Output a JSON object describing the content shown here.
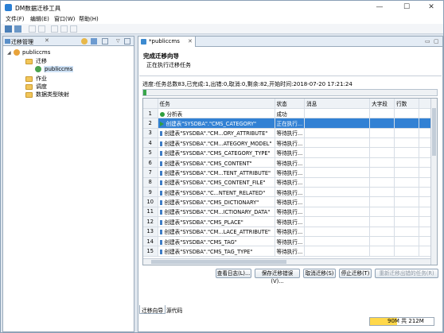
{
  "window": {
    "title": "DM数据迁移工具",
    "min": "—",
    "max": "☐",
    "close": "✕"
  },
  "menu": [
    "文件(F)",
    "编辑(E)",
    "窗口(W)",
    "帮助(H)"
  ],
  "left_panel": {
    "tab_label": "迁移管理",
    "tree": {
      "root": "publiccms",
      "migration_folder": "迁移",
      "migration_item": "publiccms",
      "job_folder": "作业",
      "schedule_folder": "调度",
      "type_map_folder": "数据类型映射"
    }
  },
  "editor_tab": {
    "label": "*publiccms"
  },
  "wizard": {
    "title": "完成迁移向导",
    "subtitle": "正在执行迁移任务",
    "progress_text": "进度:任务总数83,已完成:1,出错:0,取消:0,剩余:82,开始时间:2018-07-20 17:21:24",
    "progress_fraction": 0.012
  },
  "grid": {
    "columns": [
      "任务",
      "状态",
      "消息",
      "大字段",
      "行数"
    ],
    "rows": [
      {
        "num": "1",
        "task": "分析表",
        "status": "成功",
        "icon": "ok"
      },
      {
        "num": "2",
        "task": "创建表\"SYSDBA\".\"CMS_CATEGORY\"",
        "status": "正在执行...",
        "icon": "run"
      },
      {
        "num": "3",
        "task": "创建表\"SYSDBA\".\"CM...ORY_ATTRIBUTE\"",
        "status": "等待执行...",
        "icon": "wait"
      },
      {
        "num": "4",
        "task": "创建表\"SYSDBA\".\"CM...ATEGORY_MODEL\"",
        "status": "等待执行...",
        "icon": "wait"
      },
      {
        "num": "5",
        "task": "创建表\"SYSDBA\".\"CMS_CATEGORY_TYPE\"",
        "status": "等待执行...",
        "icon": "wait"
      },
      {
        "num": "6",
        "task": "创建表\"SYSDBA\".\"CMS_CONTENT\"",
        "status": "等待执行...",
        "icon": "wait"
      },
      {
        "num": "7",
        "task": "创建表\"SYSDBA\".\"CM...TENT_ATTRIBUTE\"",
        "status": "等待执行...",
        "icon": "wait"
      },
      {
        "num": "8",
        "task": "创建表\"SYSDBA\".\"CMS_CONTENT_FILE\"",
        "status": "等待执行...",
        "icon": "wait"
      },
      {
        "num": "9",
        "task": "创建表\"SYSDBA\".\"C...NTENT_RELATED\"",
        "status": "等待执行...",
        "icon": "wait"
      },
      {
        "num": "10",
        "task": "创建表\"SYSDBA\".\"CMS_DICTIONARY\"",
        "status": "等待执行...",
        "icon": "wait"
      },
      {
        "num": "11",
        "task": "创建表\"SYSDBA\".\"CM...ICTIONARY_DATA\"",
        "status": "等待执行...",
        "icon": "wait"
      },
      {
        "num": "12",
        "task": "创建表\"SYSDBA\".\"CMS_PLACE\"",
        "status": "等待执行...",
        "icon": "wait"
      },
      {
        "num": "13",
        "task": "创建表\"SYSDBA\".\"CM...LACE_ATTRIBUTE\"",
        "status": "等待执行...",
        "icon": "wait"
      },
      {
        "num": "14",
        "task": "创建表\"SYSDBA\".\"CMS_TAG\"",
        "status": "等待执行...",
        "icon": "wait"
      },
      {
        "num": "15",
        "task": "创建表\"SYSDBA\".\"CMS_TAG_TYPE\"",
        "status": "等待执行...",
        "icon": "wait"
      }
    ]
  },
  "buttons": {
    "view_log": "查看日志(L)...",
    "save_error": "保存迁移错误(V)...",
    "cancel_migration": "取消迁移(S)",
    "stop_migration": "停止迁移(T)",
    "retry_failed": "重新迁移出错的任务(R)"
  },
  "bottom_tabs": [
    "迁移向导",
    "源代码"
  ],
  "status": {
    "memory": "90M 共 212M",
    "memory_used_fraction": 0.42
  },
  "colors": {
    "selection": "#3281d4",
    "accent": "#2a7fd4"
  }
}
